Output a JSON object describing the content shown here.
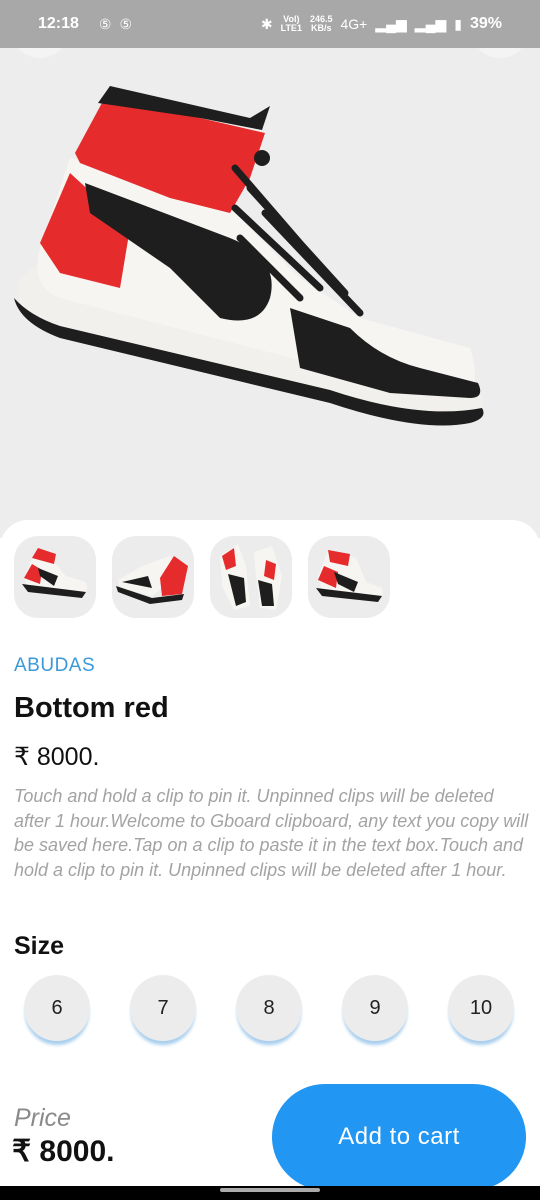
{
  "status_bar": {
    "time": "12:18",
    "left_icons": [
      "sim-icon",
      "sim-icon"
    ],
    "volte_top": "Vol)",
    "volte_bottom": "LTE1",
    "speed_value": "246.5",
    "speed_unit": "KB/s",
    "network": "4G+",
    "battery_percent": "39%"
  },
  "product": {
    "brand": "ABUDAS",
    "name": "Bottom red",
    "price": "₹ 8000.",
    "description": "Touch and hold a clip to pin it. Unpinned clips will be deleted after 1 hour.Welcome to Gboard clipboard, any text you copy will be saved here.Tap on a clip to paste it in the text box.Touch and hold a clip to pin it. Unpinned clips will be deleted after 1 hour.",
    "thumbnails": [
      "shoe-side-view",
      "shoe-back-view",
      "shoe-pair-view",
      "shoe-front-view"
    ],
    "colors": {
      "red": "#e52b2b",
      "black": "#1e1e1e",
      "white": "#f7f5f2"
    }
  },
  "size_section": {
    "label": "Size",
    "options": [
      "6",
      "7",
      "8",
      "9",
      "10"
    ]
  },
  "footer": {
    "price_label": "Price",
    "price_value": "₹ 8000.",
    "add_to_cart": "Add to cart",
    "accent": "#2196f3"
  }
}
